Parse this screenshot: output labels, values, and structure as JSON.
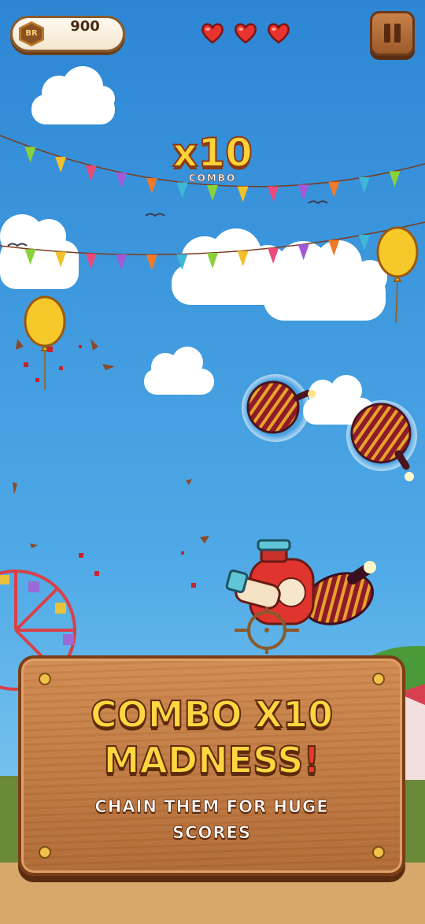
{
  "hud": {
    "coins": {
      "badge_text": "BR",
      "value": "900",
      "icon": "coin-badge-icon"
    },
    "lives": {
      "count": 3,
      "icon": "heart-icon",
      "color": "#e8332e"
    },
    "pause": {
      "icon": "pause-icon"
    }
  },
  "combo": {
    "value": "x10",
    "label": "COMBO"
  },
  "panel": {
    "title_line1": "COMBO X10",
    "title_line2": "MADNESS",
    "title_mark": "!",
    "subtitle_line1": "CHAIN THEM FOR HUGE",
    "subtitle_line2": "SCORES"
  },
  "colors": {
    "sky_top": "#2d86d4",
    "sky_bottom": "#7fc6ee",
    "combo_fill": "#ffd23a",
    "panel_wood": "#c07a42",
    "title_fill": "#ffd640",
    "accent_red": "#e8372b"
  },
  "scene_objects": {
    "balloons": [
      "yellow-balloon",
      "yellow-balloon"
    ],
    "bottles": [
      "striped-bottle",
      "striped-bottle",
      "striped-bottle",
      "red-bottle",
      "teal-bottle"
    ],
    "crosshair": "crosshair-icon",
    "ferris_wheel": "ferris-wheel"
  }
}
